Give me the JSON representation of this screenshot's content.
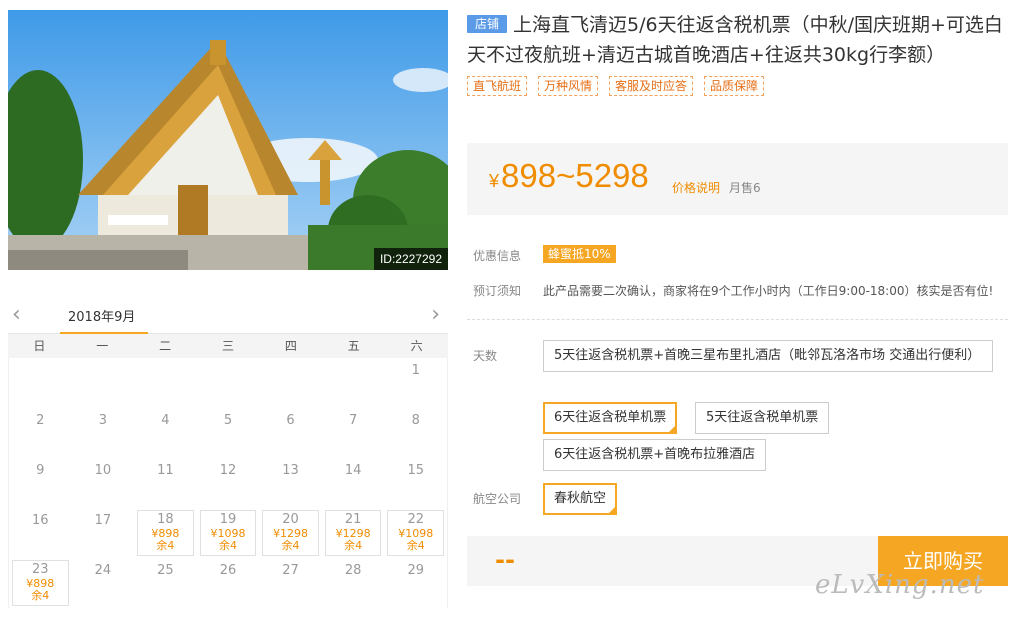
{
  "photo": {
    "id_label": "ID:2227292"
  },
  "calendar": {
    "month": "2018年9月",
    "weekdays": [
      "日",
      "一",
      "二",
      "三",
      "四",
      "五",
      "六"
    ],
    "rows": [
      [
        {
          "d": ""
        },
        {
          "d": ""
        },
        {
          "d": ""
        },
        {
          "d": ""
        },
        {
          "d": ""
        },
        {
          "d": ""
        },
        {
          "d": "1"
        }
      ],
      [
        {
          "d": "2"
        },
        {
          "d": "3"
        },
        {
          "d": "4"
        },
        {
          "d": "5"
        },
        {
          "d": "6"
        },
        {
          "d": "7"
        },
        {
          "d": "8"
        }
      ],
      [
        {
          "d": "9"
        },
        {
          "d": "10"
        },
        {
          "d": "11"
        },
        {
          "d": "12"
        },
        {
          "d": "13"
        },
        {
          "d": "14"
        },
        {
          "d": "15"
        }
      ],
      [
        {
          "d": "16"
        },
        {
          "d": "17"
        },
        {
          "d": "18",
          "p": "¥898",
          "r": "余4"
        },
        {
          "d": "19",
          "p": "¥1098",
          "r": "余4"
        },
        {
          "d": "20",
          "p": "¥1298",
          "r": "余4"
        },
        {
          "d": "21",
          "p": "¥1298",
          "r": "余4"
        },
        {
          "d": "22",
          "p": "¥1098",
          "r": "余4"
        }
      ],
      [
        {
          "d": "23",
          "p": "¥898",
          "r": "余4"
        },
        {
          "d": "24"
        },
        {
          "d": "25"
        },
        {
          "d": "26"
        },
        {
          "d": "27"
        },
        {
          "d": "28"
        },
        {
          "d": "29"
        }
      ]
    ]
  },
  "product": {
    "shop_badge": "店铺",
    "title": "上海直飞清迈5/6天往返含税机票（中秋/国庆班期+可选白天不过夜航班+清迈古城首晚酒店+往返共30kg行李额）",
    "tags": [
      "直飞航班",
      "万种风情",
      "客服及时应答",
      "品质保障"
    ],
    "price_currency": "¥",
    "price_range": "898~5298",
    "price_note": "价格说明",
    "monthly_sales": "月售6",
    "promo_label": "优惠信息",
    "promo_badge": "蜂蜜抵10%",
    "booking_label": "预订须知",
    "booking_text": "此产品需要二次确认，商家将在9个工作小时内（工作日9:00-18:00）核实是否有位!",
    "days_label": "天数",
    "day_options": [
      "5天往返含税机票+首晚三星布里扎酒店（毗邻瓦洛洛市场 交通出行便利）",
      "6天往返含税单机票",
      "5天往返含税单机票",
      "6天往返含税机票+首晚布拉雅酒店"
    ],
    "airline_label": "航空公司",
    "airline_option": "春秋航空",
    "total": "--",
    "buy_label": "立即购买"
  },
  "watermark": "eLvXing.net",
  "colors": {
    "accent": "#f5a623",
    "price": "#f08c00",
    "badge": "#5a9ae6"
  }
}
